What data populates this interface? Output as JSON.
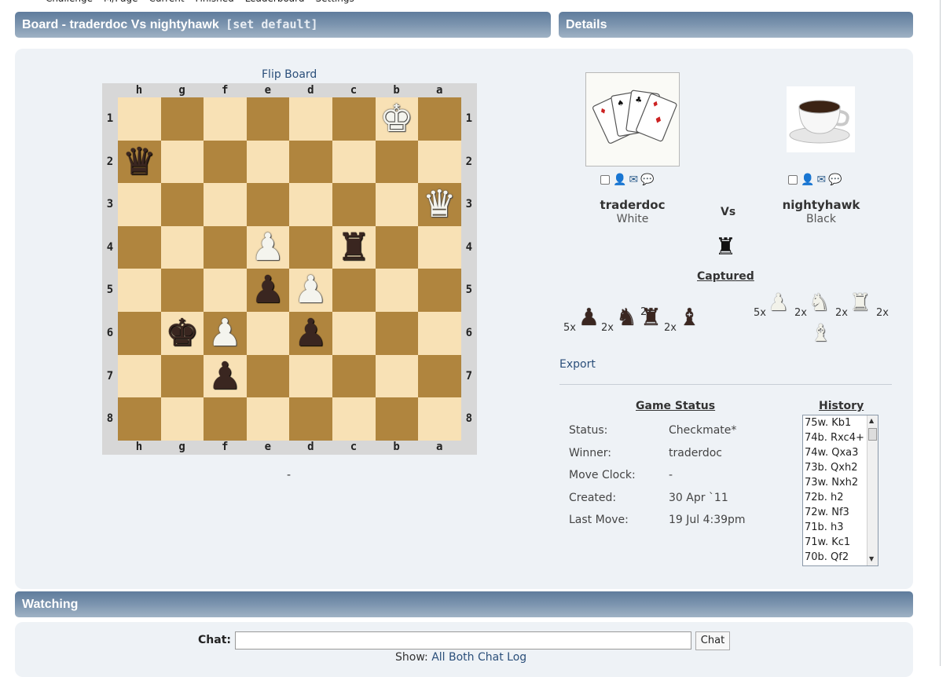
{
  "top_nav": [
    "Challenge",
    "M/Page",
    "Current",
    "Finished",
    "Leaderboard",
    "Settings"
  ],
  "board_panel": {
    "title": "Board - traderdoc Vs nightyhawk",
    "set_default": "[set default]",
    "flip_label": "Flip Board",
    "below_board": "-"
  },
  "details_panel": {
    "title": "Details"
  },
  "board": {
    "files": [
      "h",
      "g",
      "f",
      "e",
      "d",
      "c",
      "b",
      "a"
    ],
    "ranks": [
      "1",
      "2",
      "3",
      "4",
      "5",
      "6",
      "7",
      "8"
    ],
    "pieces": [
      {
        "sq": "b1",
        "color": "white",
        "type": "king",
        "glyph": "♚"
      },
      {
        "sq": "h2",
        "color": "black",
        "type": "queen",
        "glyph": "♛"
      },
      {
        "sq": "a3",
        "color": "white",
        "type": "queen",
        "glyph": "♛"
      },
      {
        "sq": "e4",
        "color": "white",
        "type": "pawn",
        "glyph": "♟"
      },
      {
        "sq": "c4",
        "color": "black",
        "type": "rook",
        "glyph": "♜"
      },
      {
        "sq": "e5",
        "color": "black",
        "type": "pawn",
        "glyph": "♟"
      },
      {
        "sq": "d5",
        "color": "white",
        "type": "pawn",
        "glyph": "♟"
      },
      {
        "sq": "g6",
        "color": "black",
        "type": "king",
        "glyph": "♚"
      },
      {
        "sq": "f6",
        "color": "white",
        "type": "pawn",
        "glyph": "♟"
      },
      {
        "sq": "d6",
        "color": "black",
        "type": "pawn",
        "glyph": "♟"
      },
      {
        "sq": "f7",
        "color": "black",
        "type": "pawn",
        "glyph": "♟"
      }
    ]
  },
  "players": {
    "white": {
      "name": "traderdoc",
      "color_label": "White",
      "avatar": "playing-cards-avatar"
    },
    "black": {
      "name": "nightyhawk",
      "color_label": "Black",
      "avatar": "coffee-cup-avatar"
    },
    "vs": "Vs"
  },
  "player_icons": [
    "checkbox",
    "user-add-icon",
    "mail-icon",
    "chat-bubble-icon"
  ],
  "captured": {
    "label": "Captured",
    "left": [
      {
        "count": "5x",
        "glyph": "♟",
        "color": "black"
      },
      {
        "count": "2x",
        "glyph": "♞",
        "color": "black"
      },
      {
        "count": "2x",
        "glyph": "♜",
        "color": "black"
      },
      {
        "count": "2x",
        "glyph": "♝",
        "color": "black"
      }
    ],
    "right": [
      {
        "count": "5x",
        "glyph": "♟",
        "color": "white"
      },
      {
        "count": "2x",
        "glyph": "♞",
        "color": "white"
      },
      {
        "count": "2x",
        "glyph": "♜",
        "color": "white"
      },
      {
        "count": "2x",
        "glyph": "♝",
        "color": "white"
      }
    ]
  },
  "export_label": "Export",
  "game_status": {
    "title": "Game Status",
    "rows": [
      {
        "label": "Status:",
        "value": "Checkmate*"
      },
      {
        "label": "Winner:",
        "value": "traderdoc"
      },
      {
        "label": "Move Clock:",
        "value": "-"
      },
      {
        "label": "Created:",
        "value": "30 Apr `11"
      },
      {
        "label": "Last Move:",
        "value": "19 Jul 4:39pm"
      }
    ]
  },
  "history": {
    "title": "History",
    "moves": [
      "75w. Kb1",
      "74b. Rxc4+",
      "74w. Qxa3",
      "73b. Qxh2",
      "73w. Nxh2",
      "72b. h2",
      "72w. Nf3",
      "71b. h3",
      "71w. Kc1",
      "70b. Qf2"
    ]
  },
  "watching": {
    "title": "Watching",
    "chat_label": "Chat:",
    "chat_button": "Chat",
    "chat_value": "",
    "show_label": "Show:",
    "show_links": [
      "All",
      "Both",
      "Chat",
      "Log"
    ]
  }
}
